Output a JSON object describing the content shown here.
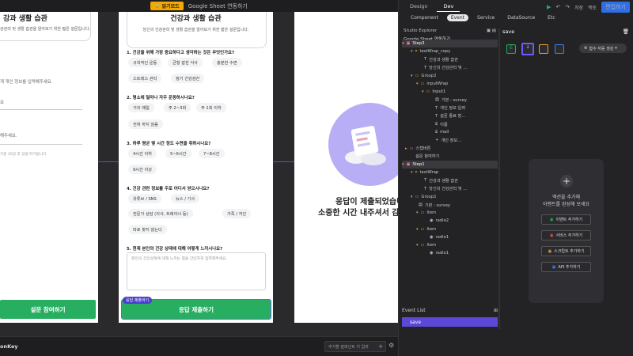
{
  "topbar": {
    "read_badge": "읽기모드",
    "title": "Google Sheet 연동하기"
  },
  "card1": {
    "title_partial": "강과 생활 습관",
    "subtitle_partial": "강관리 및 생활 습관을 알아보기 위한 짧은 설문입니다.",
    "field1": "게 개인 정보를 입력해주세요.",
    "field2": "요",
    "field3": "해주세요.",
    "note": "기준 30일 후 일괄 파기됩니다.",
    "submit": "설문 참여하기"
  },
  "survey": {
    "title": "건강과 생활 습관",
    "subtitle": "당신의 건강관리 및 생활 습관을 알아보기 위한 짧은 설문입니다.",
    "q1": "1. 건강을 위해 가장 중요하다고 생각하는 것은 무엇인가요?",
    "q1_opts": [
      "규칙적인 운동",
      "균형 잡힌 식사",
      "충분한 수면",
      "스트레스 관리",
      "정기 건강검진"
    ],
    "q2": "2. 평소에 얼마나 자주 운동하시나요?",
    "q2_opts": [
      "거의 매일",
      "주 2~3회",
      "주 1회 이하",
      "전혀 하지 않음"
    ],
    "q3": "3. 하루 평균 몇 시간 정도 수면을 취하시나요?",
    "q3_opts": [
      "4시간 이하",
      "5~6시간",
      "7~8시간",
      "9시간 이상"
    ],
    "q4": "4. 건강 관련 정보를 주로 어디서 얻으시나요?",
    "q4_opts": [
      "유튜브 / SNS",
      "뉴스 / 기사",
      "전문가 상담 (의사, 트레이너 등)",
      "가족 / 지인",
      "따로 찾지 않는다"
    ],
    "q5": "5. 현재 본인의 건강 상태에 대해 어떻게 느끼시나요?",
    "q5_placeholder": "본인의 건강상태에 대해 느끼는 점을 간단하게 입력해주세요.",
    "submit_tag": "응답 제출하기",
    "submit": "응답 제출하기"
  },
  "card3": {
    "line1": "응답이 제출되었습니",
    "line2": "소중한 시간 내주셔서 감"
  },
  "bottom": {
    "brand": "onKey",
    "search_placeholder": "추가할 컴퍼넌트 키 입력"
  },
  "panel": {
    "tabs": [
      "Design",
      "Dev"
    ],
    "active_tab": "Dev",
    "save": "저장",
    "back": "백토",
    "edit": "편집하기",
    "subtabs": [
      "Component",
      "Event",
      "Service",
      "DataSource",
      "Etc"
    ],
    "active_subtab": "Event",
    "explorer_title": "Studio Explorer",
    "root": "Google Sheet 연동하기",
    "tree": [
      {
        "label": "Step3",
        "indent": 0,
        "caret": "▾",
        "icon": "frame",
        "hl": true
      },
      {
        "label": "textWrap_copy",
        "indent": 1,
        "caret": "▾",
        "icon": "group"
      },
      {
        "label": "건강과 생활 습관",
        "indent": 3,
        "caret": "",
        "icon": "text"
      },
      {
        "label": "당신의 건강관리 및 ...",
        "indent": 3,
        "caret": "",
        "icon": "text"
      },
      {
        "label": "Group2",
        "indent": 1,
        "caret": "▾",
        "icon": "folder"
      },
      {
        "label": "inputWrap",
        "indent": 2,
        "caret": "▾",
        "icon": "folder"
      },
      {
        "label": "Input1",
        "indent": 3,
        "caret": "▾",
        "icon": "folder"
      },
      {
        "label": "기본 : survey",
        "indent": 5,
        "caret": "",
        "icon": "box"
      },
      {
        "label": "개인 정보 입력",
        "indent": 5,
        "caret": "",
        "icon": "text"
      },
      {
        "label": "설문 종료 방...",
        "indent": 5,
        "caret": "",
        "icon": "text"
      },
      {
        "label": "이름",
        "indent": 5,
        "caret": "",
        "icon": "input"
      },
      {
        "label": "mail",
        "indent": 5,
        "caret": "",
        "icon": "input"
      },
      {
        "label": "개인 정보...",
        "indent": 5,
        "caret": "",
        "icon": "plus"
      },
      {
        "label": "스텝버튼",
        "indent": 0,
        "caret": "▸",
        "icon": "pink"
      },
      {
        "label": "설문 참여하기",
        "indent": 1,
        "caret": "",
        "icon": ""
      },
      {
        "label": "Step1",
        "indent": 0,
        "caret": "▾",
        "icon": "frame",
        "hl": true
      },
      {
        "label": "textWrap",
        "indent": 1,
        "caret": "▾",
        "icon": "group"
      },
      {
        "label": "건강과 생활 습관",
        "indent": 3,
        "caret": "",
        "icon": "text"
      },
      {
        "label": "당신의 건강관리 및 ...",
        "indent": 3,
        "caret": "",
        "icon": "text"
      },
      {
        "label": "Group1",
        "indent": 1,
        "caret": "▾",
        "icon": "folder"
      },
      {
        "label": "기본 : survey",
        "indent": 2,
        "caret": "",
        "icon": "box"
      },
      {
        "label": "Item",
        "indent": 2,
        "caret": "▾",
        "icon": "folder"
      },
      {
        "label": "radio2",
        "indent": 4,
        "caret": "",
        "icon": "radio"
      },
      {
        "label": "Item",
        "indent": 2,
        "caret": "▾",
        "icon": "folder"
      },
      {
        "label": "radio1",
        "indent": 4,
        "caret": "",
        "icon": "radio"
      },
      {
        "label": "Item",
        "indent": 2,
        "caret": "▾",
        "icon": "folder"
      },
      {
        "label": "radio1",
        "indent": 4,
        "caret": "",
        "icon": "radio"
      }
    ],
    "event_list": "Event List",
    "event_item": "save",
    "detail_title": "save",
    "dropdown": "함수 자동 생성",
    "empty_line1": "액션을 추가해",
    "empty_line2": "이벤트를 완성해 보세요",
    "add_buttons": [
      "이벤트 추가하기",
      "서비스 추가하기",
      "스크립트 추가하기",
      "API 추가하기"
    ],
    "add_button_icons": [
      "E",
      "S",
      "S",
      "A"
    ],
    "add_button_colors": [
      "#1fae5b",
      "#e0583e",
      "#e6a23c",
      "#3b82f6"
    ]
  }
}
